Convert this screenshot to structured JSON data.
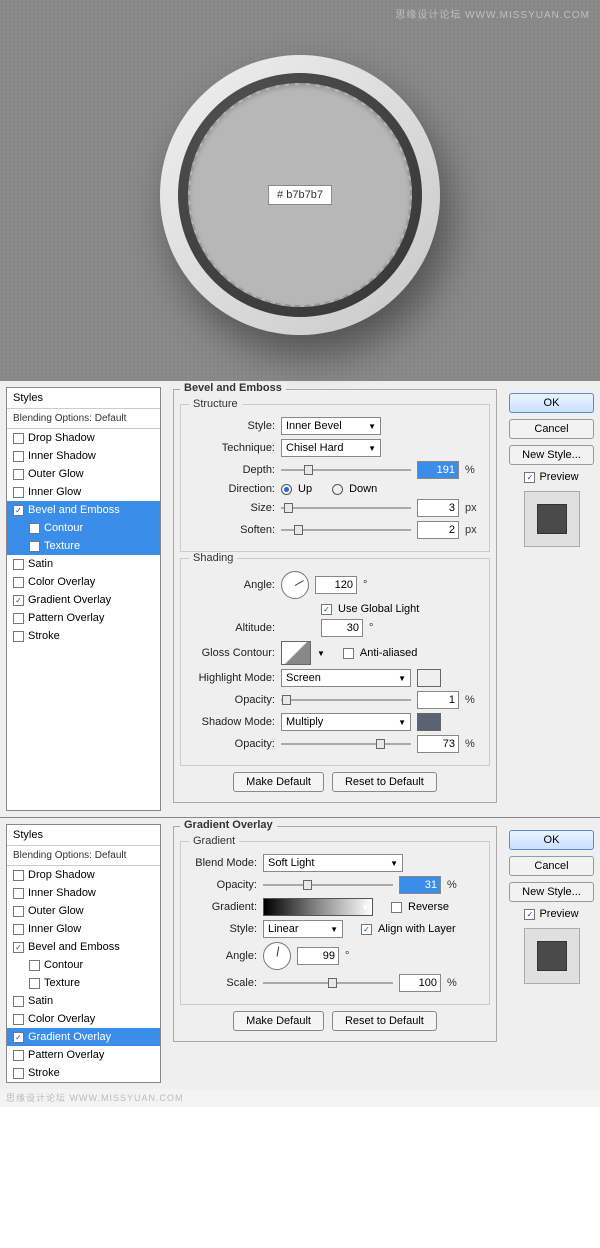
{
  "watermark": "思缘设计论坛 WWW.MISSYUAN.COM",
  "footer_watermark": "思缘设计论坛 WWW.MISSYUAN.COM",
  "knob": {
    "color_label": "#  b7b7b7"
  },
  "common": {
    "styles_header": "Styles",
    "blending_default": "Blending Options: Default",
    "drop_shadow": "Drop Shadow",
    "inner_shadow": "Inner Shadow",
    "outer_glow": "Outer Glow",
    "inner_glow": "Inner Glow",
    "bevel_emboss": "Bevel and Emboss",
    "contour": "Contour",
    "texture": "Texture",
    "satin": "Satin",
    "color_overlay": "Color Overlay",
    "gradient_overlay": "Gradient Overlay",
    "pattern_overlay": "Pattern Overlay",
    "stroke": "Stroke",
    "ok": "OK",
    "cancel": "Cancel",
    "new_style": "New Style...",
    "preview": "Preview",
    "make_default": "Make Default",
    "reset_default": "Reset to Default",
    "pct": "%",
    "px": "px",
    "deg": "°"
  },
  "panel1": {
    "title": "Bevel and Emboss",
    "structure": "Structure",
    "style_lbl": "Style:",
    "style_val": "Inner Bevel",
    "technique_lbl": "Technique:",
    "technique_val": "Chisel Hard",
    "depth_lbl": "Depth:",
    "depth_val": "191",
    "direction_lbl": "Direction:",
    "up": "Up",
    "down": "Down",
    "size_lbl": "Size:",
    "size_val": "3",
    "soften_lbl": "Soften:",
    "soften_val": "2",
    "shading": "Shading",
    "angle_lbl": "Angle:",
    "angle_val": "120",
    "global_light": "Use Global Light",
    "altitude_lbl": "Altitude:",
    "altitude_val": "30",
    "gloss_contour_lbl": "Gloss Contour:",
    "anti_aliased": "Anti-aliased",
    "highlight_mode_lbl": "Highlight Mode:",
    "highlight_mode_val": "Screen",
    "highlight_color": "#ffffff",
    "opacity_lbl": "Opacity:",
    "highlight_opacity": "1",
    "shadow_mode_lbl": "Shadow Mode:",
    "shadow_mode_val": "Multiply",
    "shadow_color": "#5a6373",
    "shadow_opacity": "73"
  },
  "panel2": {
    "title": "Gradient Overlay",
    "gradient": "Gradient",
    "blend_mode_lbl": "Blend Mode:",
    "blend_mode_val": "Soft Light",
    "opacity_lbl": "Opacity:",
    "opacity_val": "31",
    "gradient_lbl": "Gradient:",
    "reverse": "Reverse",
    "style_lbl": "Style:",
    "style_val": "Linear",
    "align_layer": "Align with Layer",
    "angle_lbl": "Angle:",
    "angle_val": "99",
    "scale_lbl": "Scale:",
    "scale_val": "100"
  }
}
